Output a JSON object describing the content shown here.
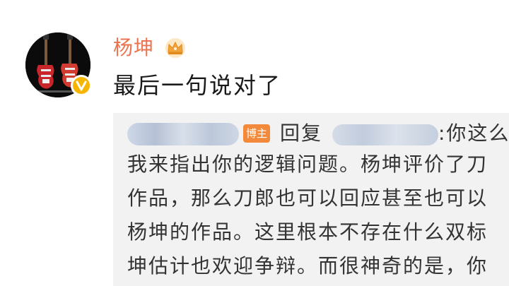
{
  "post": {
    "username": "杨坤",
    "comment": "最后一句说对了",
    "icons": {
      "crown": "crown-icon",
      "verified": "verified-v-icon"
    },
    "colors": {
      "username": "#eb7350",
      "verified": "#f7b500",
      "blogger_badge": "#f38a3b"
    }
  },
  "quote": {
    "badge": "博主",
    "reply_label": "回复",
    "first_line_tail": ":你这么",
    "lines": [
      "我来指出你的逻辑问题。杨坤评价了刀",
      "作品，那么刀郎也可以回应甚至也可以",
      "杨坤的作品。这里根本不存在什么双标",
      "坤估计也欢迎争辩。而很神奇的是，你"
    ]
  }
}
